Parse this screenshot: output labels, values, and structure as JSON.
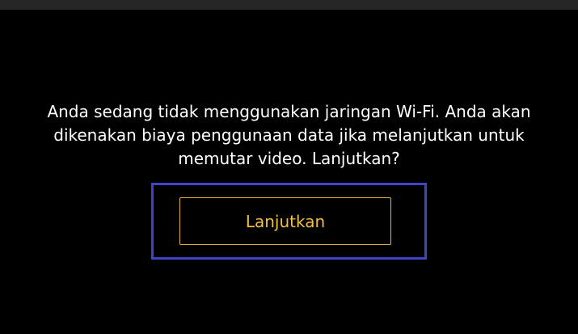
{
  "dialog": {
    "message_lines": [
      "Anda sedang tidak menggunakan jaringan Wi-Fi. Anda akan",
      "dikenakan biaya penggunaan data jika melanjutkan untuk",
      "memutar video. Lanjutkan?"
    ],
    "continue_label": "Lanjutkan"
  },
  "colors": {
    "background": "#000000",
    "top_bar": "#262626",
    "text": "#ffffff",
    "button_accent": "#f2c040",
    "focus_ring": "#3d44c8"
  }
}
